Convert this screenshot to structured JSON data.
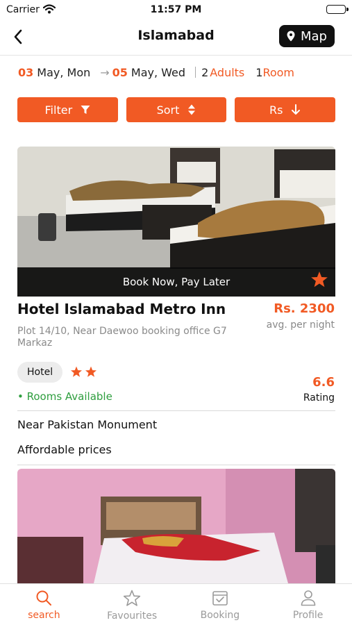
{
  "status_bar": {
    "carrier": "Carrier",
    "time": "11:57 PM"
  },
  "nav": {
    "title": "Islamabad",
    "map_label": "Map"
  },
  "search": {
    "checkin_day": "03",
    "checkin_rest": "May, Mon",
    "checkout_day": "05",
    "checkout_rest": "May, Wed",
    "adults_count": "2",
    "adults_label": "Adults",
    "rooms_count": "1",
    "rooms_label": "Room"
  },
  "actions": {
    "filter_label": "Filter",
    "sort_label": "Sort",
    "currency_label": "Rs"
  },
  "hotels": [
    {
      "banner": "Book Now, Pay Later",
      "name": "Hotel Islamabad Metro Inn",
      "price": "Rs. 2300",
      "price_sub": "avg. per night",
      "address": "Plot 14/10, Near Daewoo booking office G7 Markaz",
      "type": "Hotel",
      "stars": 2,
      "rating": "6.6",
      "rating_label": "Rating",
      "availability": "• Rooms Available",
      "features": [
        "Near Pakistan Monument",
        "Affordable prices"
      ]
    }
  ],
  "tabs": [
    {
      "label": "search",
      "icon": "search-icon",
      "active": true
    },
    {
      "label": "Favourites",
      "icon": "star-icon",
      "active": false
    },
    {
      "label": "Booking",
      "icon": "booking-icon",
      "active": false
    },
    {
      "label": "Profile",
      "icon": "profile-icon",
      "active": false
    }
  ],
  "colors": {
    "accent": "#f15a24",
    "available": "#2e9e3e",
    "dark": "#111111"
  }
}
